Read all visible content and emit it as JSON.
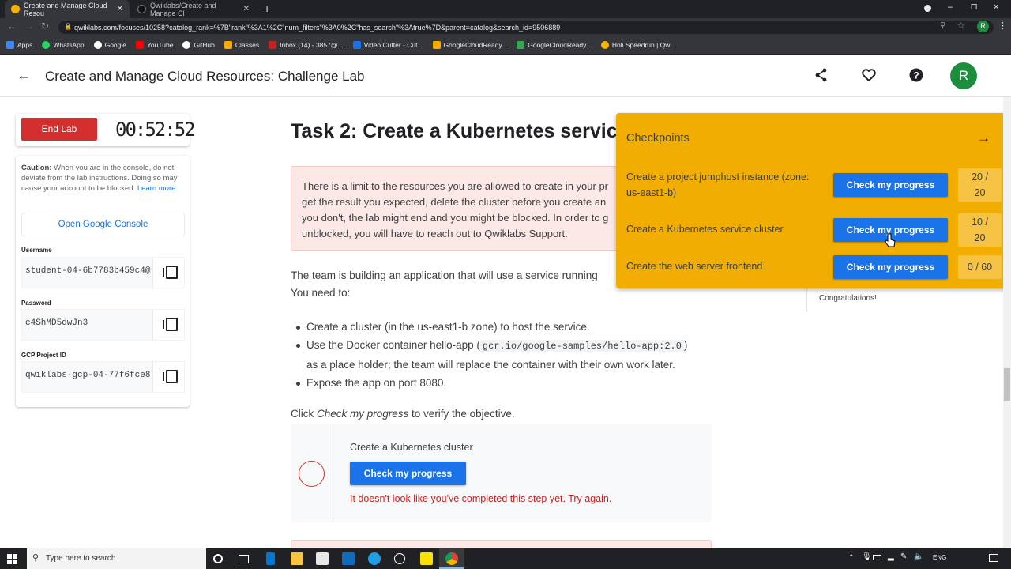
{
  "browser": {
    "tabs": [
      {
        "title": "Create and Manage Cloud Resou",
        "active": true
      },
      {
        "title": "Qwiklabs/Create and Manage Cl",
        "active": false
      }
    ],
    "url": "qwiklabs.com/focuses/10258?catalog_rank=%7B\"rank\"%3A1%2C\"num_filters\"%3A0%2C\"has_search\"%3Atrue%7D&parent=catalog&search_id=9506889",
    "bookmarks": [
      "Apps",
      "WhatsApp",
      "Google",
      "YouTube",
      "GitHub",
      "Classes",
      "Inbox (14) - 3857@...",
      "Video Cutter - Cut...",
      "GoogleCloudReady...",
      "GoogleCloudReady...",
      "Holi Speedrun | Qw..."
    ]
  },
  "header": {
    "title": "Create and Manage Cloud Resources: Challenge Lab",
    "avatar_letter": "R"
  },
  "lab_panel": {
    "end_lab_label": "End Lab",
    "timer": "00:52:52",
    "caution_label": "Caution:",
    "caution_text": "When you are in the console, do not deviate from the lab instructions. Doing so may cause your account to be blocked.",
    "learn_more": "Learn more.",
    "open_console": "Open Google Console",
    "username_label": "Username",
    "username": "student-04-6b7783b459c4@",
    "password_label": "Password",
    "password": "c4ShMD5dwJn3",
    "project_label": "GCP Project ID",
    "project_id": "qwiklabs-gcp-04-77f6fce8"
  },
  "main": {
    "task_title": "Task 2: Create a Kubernetes servic",
    "warning_lines": [
      "There is a limit to the resources you are allowed to create in your pr",
      "get the result you expected, delete the cluster before you create an",
      "you don't, the lab might end and you might be blocked. In order to g",
      "unblocked, you will have to reach out to Qwiklabs Support."
    ],
    "intro_line1": "The team is building an application that will use a service running",
    "intro_line2": "You need to:",
    "bullet1": "Create a cluster (in the us-east1-b zone) to host the service.",
    "bullet2_pre": "Use the Docker container hello-app (",
    "bullet2_code": "gcr.io/google-samples/hello-app:2.0",
    "bullet2_post": ")",
    "bullet2_line2": "as a place holder; the team will replace the container with their own work later.",
    "bullet3": "Expose the app on port 8080.",
    "click_pre": "Click ",
    "click_em": "Check my progress",
    "click_post": " to verify the objective.",
    "progress_title": "Create a Kubernetes cluster",
    "progress_button": "Check my progress",
    "progress_error": "It doesn't look like you've completed this step yet. Try again.",
    "congrats": "Congratulations!"
  },
  "checkpoints": {
    "title": "Checkpoints",
    "items": [
      {
        "label_line1": "Create a project jumphost instance (zone:",
        "label_line2": "us-east1-b)",
        "button": "Check my progress",
        "score_line1": "20 /",
        "score_line2": "20"
      },
      {
        "label_line1": "Create a Kubernetes service cluster",
        "label_line2": "",
        "button": "Check my progress",
        "score_line1": "10 /",
        "score_line2": "20"
      },
      {
        "label_line1": "Create the web server frontend",
        "label_line2": "",
        "button": "Check my progress",
        "score_line1": "0 / 60",
        "score_line2": ""
      }
    ]
  },
  "taskbar": {
    "search_placeholder": "Type here to search",
    "lang": "ENG"
  },
  "colors": {
    "end_lab": "#d32f2f",
    "primary_button": "#1a73e8",
    "checkpoint_panel": "#f1ad00",
    "warning_bg": "#fce8e6",
    "avatar": "#1e8e3e"
  }
}
